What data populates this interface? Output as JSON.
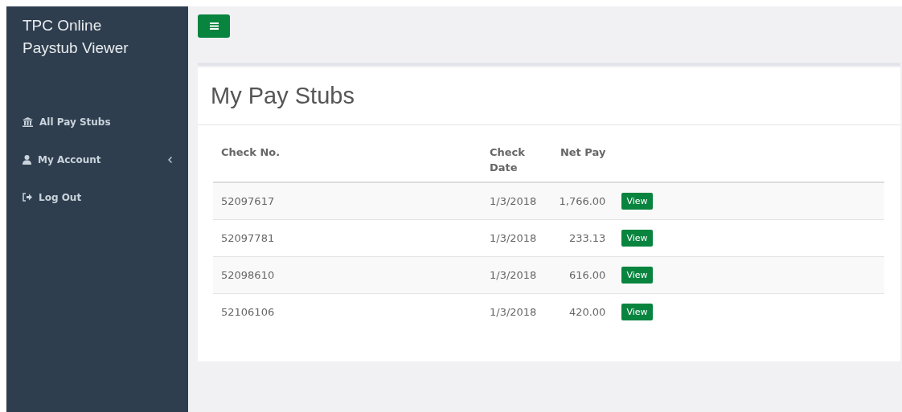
{
  "sidebar": {
    "title": "TPC Online Paystub Viewer",
    "items": [
      {
        "label": "All Pay Stubs",
        "kind": "bank",
        "has_caret": false
      },
      {
        "label": "My Account",
        "kind": "user",
        "has_caret": true
      },
      {
        "label": "Log Out",
        "kind": "logout",
        "has_caret": false
      }
    ]
  },
  "page": {
    "heading": "My Pay Stubs"
  },
  "table": {
    "columns": [
      "Check No.",
      "Check Date",
      "Net Pay"
    ],
    "rows": [
      {
        "check_no": "52097617",
        "check_date": "1/3/2018",
        "net_pay": "1,766.00",
        "action": "View"
      },
      {
        "check_no": "52097781",
        "check_date": "1/3/2018",
        "net_pay": "233.13",
        "action": "View"
      },
      {
        "check_no": "52098610",
        "check_date": "1/3/2018",
        "net_pay": "616.00",
        "action": "View"
      },
      {
        "check_no": "52106106",
        "check_date": "1/3/2018",
        "net_pay": "420.00",
        "action": "View"
      }
    ]
  }
}
